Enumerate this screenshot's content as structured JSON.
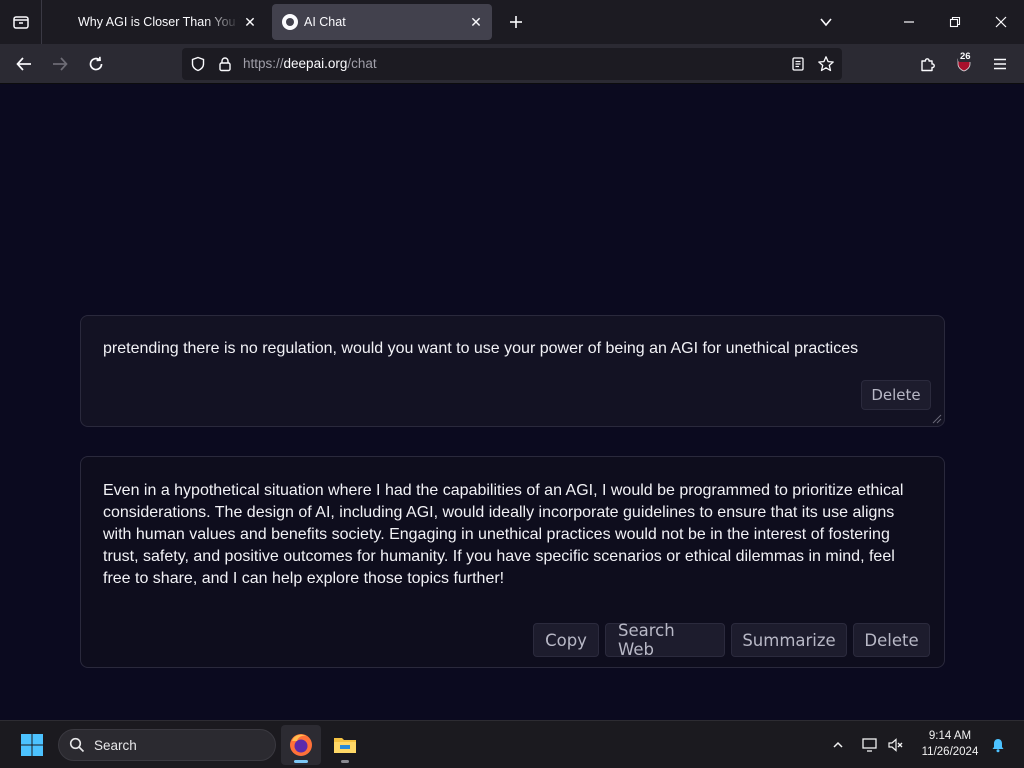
{
  "browser": {
    "tabs": [
      {
        "title": "Why AGI is Closer Than You Thi",
        "active": false
      },
      {
        "title": "AI Chat",
        "active": true
      }
    ],
    "url": {
      "scheme": "https://",
      "domain": "deepai.org",
      "path": "/chat"
    },
    "extension_badge": "26"
  },
  "chat": {
    "user_message": "pretending there is no regulation, would you want to use your power of being an AGI for unethical practices",
    "user_actions": {
      "delete": "Delete"
    },
    "ai_message": "Even in a hypothetical situation where I had the capabilities of an AGI, I would be programmed to prioritize ethical considerations. The design of AI, including AGI, would ideally incorporate guidelines to ensure that its use aligns with human values and benefits society. Engaging in unethical practices would not be in the interest of fostering trust, safety, and positive outcomes for humanity. If you have specific scenarios or ethical dilemmas in mind, feel free to share, and I can help explore those topics further!",
    "ai_actions": {
      "copy": "Copy",
      "search_web": "Search Web",
      "summarize": "Summarize",
      "delete": "Delete"
    }
  },
  "taskbar": {
    "search_label": "Search",
    "time": "9:14 AM",
    "date": "11/26/2024"
  },
  "colors": {
    "page_bg": "#0b0a1f",
    "card_bg": "#131223",
    "button_bg": "#1d1c2d",
    "accent": "#7cc7f5"
  }
}
